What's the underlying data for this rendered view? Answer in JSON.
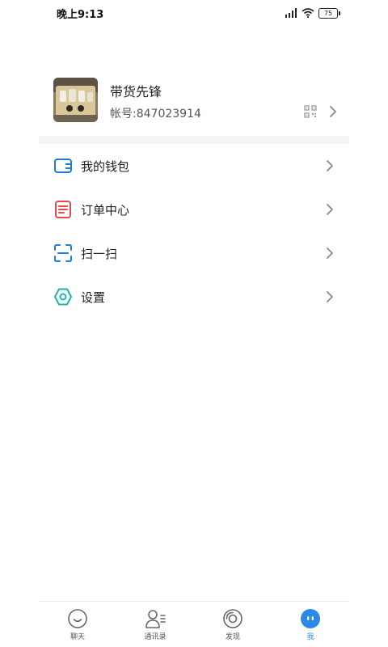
{
  "status_bar": {
    "time": "晚上9:13",
    "battery": "75"
  },
  "profile": {
    "name": "带货先锋",
    "account": "帐号:847023914"
  },
  "menu": [
    {
      "label": "我的钱包",
      "icon": "wallet-icon",
      "color": "#1e7be0"
    },
    {
      "label": "订单中心",
      "icon": "order-icon",
      "color": "#e84747"
    },
    {
      "label": "扫一扫",
      "icon": "scan-icon",
      "color": "#1e7be0"
    },
    {
      "label": "设置",
      "icon": "settings-icon",
      "color": "#19b8a6"
    }
  ],
  "bottom_nav": [
    {
      "label": "聊天",
      "icon": "chat-icon",
      "active": false
    },
    {
      "label": "通讯录",
      "icon": "contacts-icon",
      "active": false
    },
    {
      "label": "发现",
      "icon": "discover-icon",
      "active": false
    },
    {
      "label": "我",
      "icon": "me-icon",
      "active": true
    }
  ],
  "colors": {
    "accent": "#2b8ae6"
  }
}
